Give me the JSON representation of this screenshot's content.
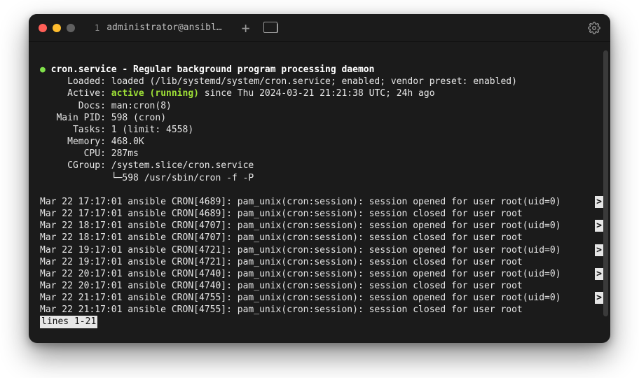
{
  "tab": {
    "number": "1",
    "title": "administrator@ansibl…"
  },
  "service": {
    "bullet": "●",
    "name_line": "cron.service - Regular background program processing daemon",
    "loaded_label": "     Loaded:",
    "loaded_value": " loaded (/lib/systemd/system/cron.service; enabled; vendor preset: enabled)",
    "active_label": "     Active:",
    "active_value": "active (running)",
    "active_suffix": " since Thu 2024-03-21 21:21:38 UTC; 24h ago",
    "docs_label": "       Docs:",
    "docs_value": " man:cron(8)",
    "mainpid_label": "   Main PID:",
    "mainpid_value": " 598 (cron)",
    "tasks_label": "      Tasks:",
    "tasks_value": " 1 (limit: 4558)",
    "memory_label": "     Memory:",
    "memory_value": " 468.0K",
    "cpu_label": "        CPU:",
    "cpu_value": " 287ms",
    "cgroup_label": "     CGroup:",
    "cgroup_value": " /system.slice/cron.service",
    "cgroup_tree": "             └─598 /usr/sbin/cron -f -P"
  },
  "truncation_mark": ">",
  "logs": [
    {
      "text": "Mar 22 17:17:01 ansible CRON[4689]: pam_unix(cron:session): session opened for user root(uid=0)",
      "truncated": true
    },
    {
      "text": "Mar 22 17:17:01 ansible CRON[4689]: pam_unix(cron:session): session closed for user root",
      "truncated": false
    },
    {
      "text": "Mar 22 18:17:01 ansible CRON[4707]: pam_unix(cron:session): session opened for user root(uid=0)",
      "truncated": true
    },
    {
      "text": "Mar 22 18:17:01 ansible CRON[4707]: pam_unix(cron:session): session closed for user root",
      "truncated": false
    },
    {
      "text": "Mar 22 19:17:01 ansible CRON[4721]: pam_unix(cron:session): session opened for user root(uid=0)",
      "truncated": true
    },
    {
      "text": "Mar 22 19:17:01 ansible CRON[4721]: pam_unix(cron:session): session closed for user root",
      "truncated": false
    },
    {
      "text": "Mar 22 20:17:01 ansible CRON[4740]: pam_unix(cron:session): session opened for user root(uid=0)",
      "truncated": true
    },
    {
      "text": "Mar 22 20:17:01 ansible CRON[4740]: pam_unix(cron:session): session closed for user root",
      "truncated": false
    },
    {
      "text": "Mar 22 21:17:01 ansible CRON[4755]: pam_unix(cron:session): session opened for user root(uid=0)",
      "truncated": true
    },
    {
      "text": "Mar 22 21:17:01 ansible CRON[4755]: pam_unix(cron:session): session closed for user root",
      "truncated": false
    }
  ],
  "pager_status": "lines 1-21"
}
